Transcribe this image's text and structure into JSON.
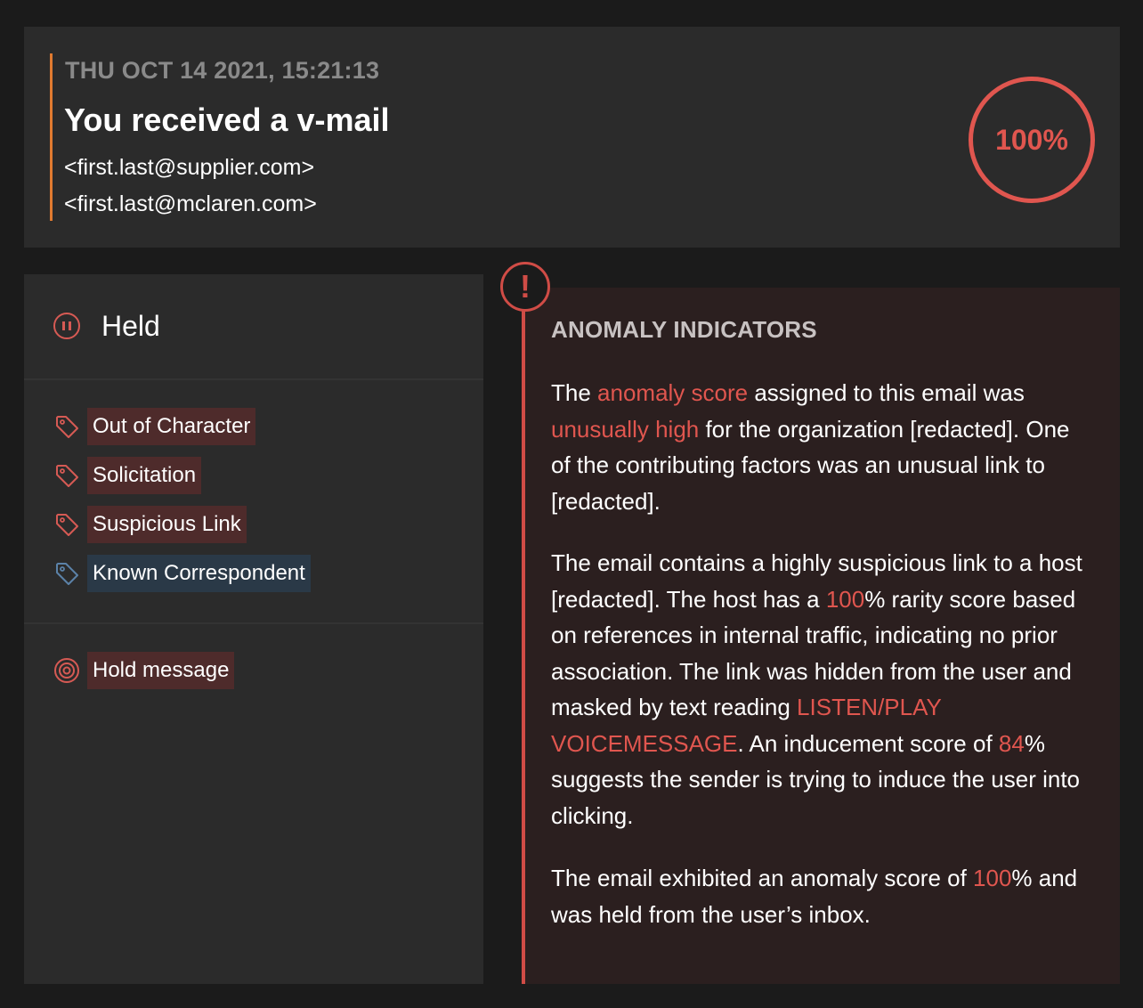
{
  "header": {
    "date": "THU OCT 14 2021, 15:21:13",
    "title": "You received a v-mail",
    "from": "<first.last@supplier.com>",
    "to": "<first.last@mclaren.com>",
    "score": "100%"
  },
  "status": {
    "icon": "pause-icon",
    "label": "Held"
  },
  "tags": [
    {
      "label": "Out of Character",
      "icon": "tag-icon",
      "color": "#d65a54"
    },
    {
      "label": "Solicitation",
      "icon": "tag-icon",
      "color": "#d65a54"
    },
    {
      "label": "Suspicious Link",
      "icon": "tag-icon",
      "color": "#d65a54"
    },
    {
      "label": "Known Correspondent",
      "icon": "tag-icon",
      "color": "#5b82a8"
    }
  ],
  "action": {
    "icon": "target-icon",
    "label": "Hold message"
  },
  "anomaly": {
    "alert_icon": "!",
    "heading": "ANOMALY INDICATORS",
    "p1": {
      "t1": "The ",
      "h1": "anomaly score",
      "t2": " assigned to this email was ",
      "h2": "unusually high",
      "t3": " for the organization [redacted]. One of the contributing factors was an unusual link to [redacted]."
    },
    "p2": {
      "t1": "The email contains a highly suspicious link to a host [redacted]. The host has a ",
      "h1": "100",
      "t2": "% rarity score based on references in internal traffic, indicating no prior association. The link was hidden from the user and masked by text reading ",
      "h2": "LISTEN/PLAY VOICEMESSAGE",
      "t3": ". An inducement score of ",
      "h3": "84",
      "t4": "% suggests the sender is trying to induce the user into clicking."
    },
    "p3": {
      "t1": "The email exhibited an anomaly score of ",
      "h1": "100",
      "t2": "% and was held from the user’s inbox."
    }
  },
  "colors": {
    "accent_red": "#e0564f",
    "accent_orange": "#e07a30",
    "tag_red_bg": "#4e2b2b",
    "tag_blue_bg": "#2a3947"
  }
}
